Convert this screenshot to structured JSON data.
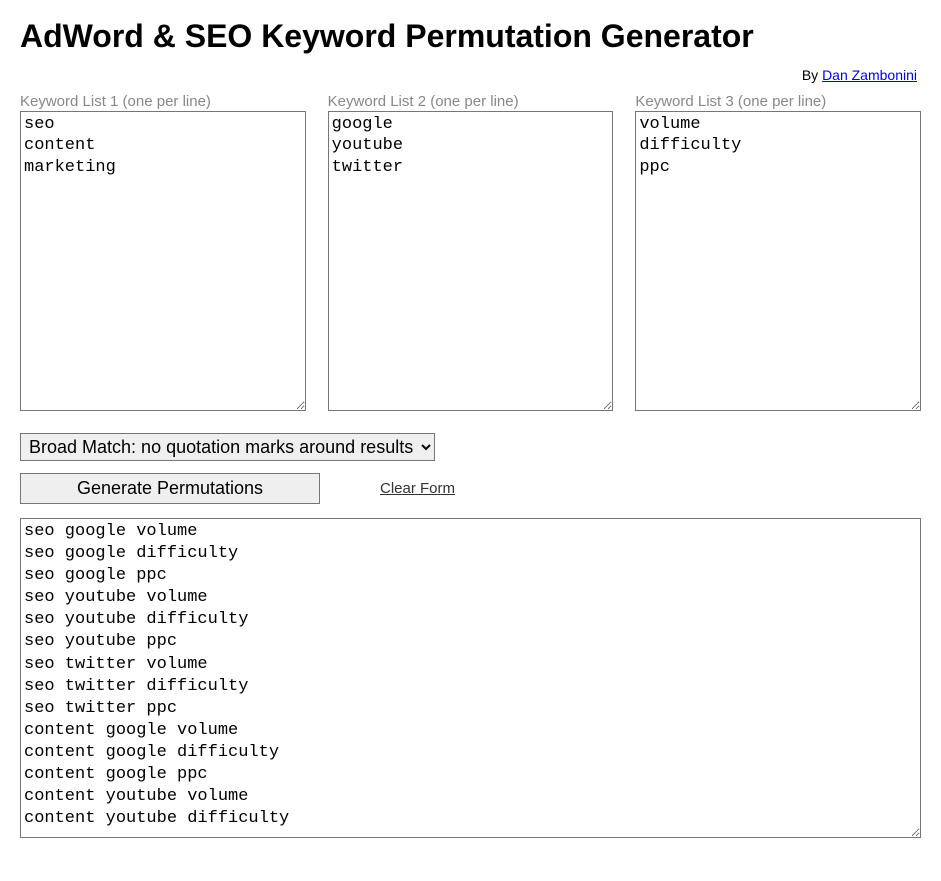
{
  "title": "AdWord & SEO Keyword Permutation Generator",
  "byline_prefix": "By ",
  "byline_author": "Dan Zambonini",
  "lists": [
    {
      "label": "Keyword List 1 (one per line)",
      "value": "seo\ncontent\nmarketing"
    },
    {
      "label": "Keyword List 2 (one per line)",
      "value": "google\nyoutube\ntwitter"
    },
    {
      "label": "Keyword List 3 (one per line)",
      "value": "volume\ndifficulty\nppc"
    }
  ],
  "match_select": {
    "selected": "Broad Match: no quotation marks around results"
  },
  "generate_button": "Generate Permutations",
  "clear_link": "Clear Form",
  "results": "seo google volume\nseo google difficulty\nseo google ppc\nseo youtube volume\nseo youtube difficulty\nseo youtube ppc\nseo twitter volume\nseo twitter difficulty\nseo twitter ppc\ncontent google volume\ncontent google difficulty\ncontent google ppc\ncontent youtube volume\ncontent youtube difficulty"
}
